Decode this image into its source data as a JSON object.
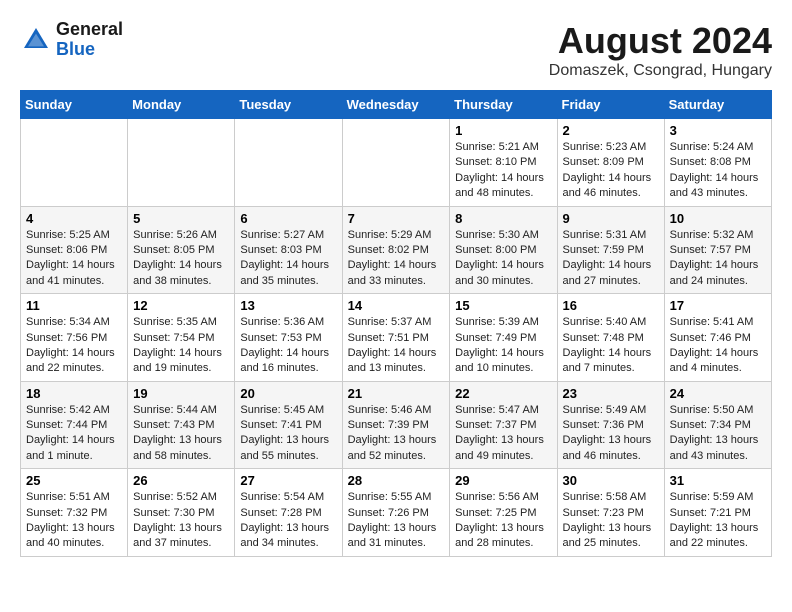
{
  "header": {
    "logo_general": "General",
    "logo_blue": "Blue",
    "month_year": "August 2024",
    "location": "Domaszek, Csongrad, Hungary"
  },
  "days_of_week": [
    "Sunday",
    "Monday",
    "Tuesday",
    "Wednesday",
    "Thursday",
    "Friday",
    "Saturday"
  ],
  "weeks": [
    [
      {
        "day": "",
        "info": ""
      },
      {
        "day": "",
        "info": ""
      },
      {
        "day": "",
        "info": ""
      },
      {
        "day": "",
        "info": ""
      },
      {
        "day": "1",
        "info": "Sunrise: 5:21 AM\nSunset: 8:10 PM\nDaylight: 14 hours\nand 48 minutes."
      },
      {
        "day": "2",
        "info": "Sunrise: 5:23 AM\nSunset: 8:09 PM\nDaylight: 14 hours\nand 46 minutes."
      },
      {
        "day": "3",
        "info": "Sunrise: 5:24 AM\nSunset: 8:08 PM\nDaylight: 14 hours\nand 43 minutes."
      }
    ],
    [
      {
        "day": "4",
        "info": "Sunrise: 5:25 AM\nSunset: 8:06 PM\nDaylight: 14 hours\nand 41 minutes."
      },
      {
        "day": "5",
        "info": "Sunrise: 5:26 AM\nSunset: 8:05 PM\nDaylight: 14 hours\nand 38 minutes."
      },
      {
        "day": "6",
        "info": "Sunrise: 5:27 AM\nSunset: 8:03 PM\nDaylight: 14 hours\nand 35 minutes."
      },
      {
        "day": "7",
        "info": "Sunrise: 5:29 AM\nSunset: 8:02 PM\nDaylight: 14 hours\nand 33 minutes."
      },
      {
        "day": "8",
        "info": "Sunrise: 5:30 AM\nSunset: 8:00 PM\nDaylight: 14 hours\nand 30 minutes."
      },
      {
        "day": "9",
        "info": "Sunrise: 5:31 AM\nSunset: 7:59 PM\nDaylight: 14 hours\nand 27 minutes."
      },
      {
        "day": "10",
        "info": "Sunrise: 5:32 AM\nSunset: 7:57 PM\nDaylight: 14 hours\nand 24 minutes."
      }
    ],
    [
      {
        "day": "11",
        "info": "Sunrise: 5:34 AM\nSunset: 7:56 PM\nDaylight: 14 hours\nand 22 minutes."
      },
      {
        "day": "12",
        "info": "Sunrise: 5:35 AM\nSunset: 7:54 PM\nDaylight: 14 hours\nand 19 minutes."
      },
      {
        "day": "13",
        "info": "Sunrise: 5:36 AM\nSunset: 7:53 PM\nDaylight: 14 hours\nand 16 minutes."
      },
      {
        "day": "14",
        "info": "Sunrise: 5:37 AM\nSunset: 7:51 PM\nDaylight: 14 hours\nand 13 minutes."
      },
      {
        "day": "15",
        "info": "Sunrise: 5:39 AM\nSunset: 7:49 PM\nDaylight: 14 hours\nand 10 minutes."
      },
      {
        "day": "16",
        "info": "Sunrise: 5:40 AM\nSunset: 7:48 PM\nDaylight: 14 hours\nand 7 minutes."
      },
      {
        "day": "17",
        "info": "Sunrise: 5:41 AM\nSunset: 7:46 PM\nDaylight: 14 hours\nand 4 minutes."
      }
    ],
    [
      {
        "day": "18",
        "info": "Sunrise: 5:42 AM\nSunset: 7:44 PM\nDaylight: 14 hours\nand 1 minute."
      },
      {
        "day": "19",
        "info": "Sunrise: 5:44 AM\nSunset: 7:43 PM\nDaylight: 13 hours\nand 58 minutes."
      },
      {
        "day": "20",
        "info": "Sunrise: 5:45 AM\nSunset: 7:41 PM\nDaylight: 13 hours\nand 55 minutes."
      },
      {
        "day": "21",
        "info": "Sunrise: 5:46 AM\nSunset: 7:39 PM\nDaylight: 13 hours\nand 52 minutes."
      },
      {
        "day": "22",
        "info": "Sunrise: 5:47 AM\nSunset: 7:37 PM\nDaylight: 13 hours\nand 49 minutes."
      },
      {
        "day": "23",
        "info": "Sunrise: 5:49 AM\nSunset: 7:36 PM\nDaylight: 13 hours\nand 46 minutes."
      },
      {
        "day": "24",
        "info": "Sunrise: 5:50 AM\nSunset: 7:34 PM\nDaylight: 13 hours\nand 43 minutes."
      }
    ],
    [
      {
        "day": "25",
        "info": "Sunrise: 5:51 AM\nSunset: 7:32 PM\nDaylight: 13 hours\nand 40 minutes."
      },
      {
        "day": "26",
        "info": "Sunrise: 5:52 AM\nSunset: 7:30 PM\nDaylight: 13 hours\nand 37 minutes."
      },
      {
        "day": "27",
        "info": "Sunrise: 5:54 AM\nSunset: 7:28 PM\nDaylight: 13 hours\nand 34 minutes."
      },
      {
        "day": "28",
        "info": "Sunrise: 5:55 AM\nSunset: 7:26 PM\nDaylight: 13 hours\nand 31 minutes."
      },
      {
        "day": "29",
        "info": "Sunrise: 5:56 AM\nSunset: 7:25 PM\nDaylight: 13 hours\nand 28 minutes."
      },
      {
        "day": "30",
        "info": "Sunrise: 5:58 AM\nSunset: 7:23 PM\nDaylight: 13 hours\nand 25 minutes."
      },
      {
        "day": "31",
        "info": "Sunrise: 5:59 AM\nSunset: 7:21 PM\nDaylight: 13 hours\nand 22 minutes."
      }
    ]
  ]
}
